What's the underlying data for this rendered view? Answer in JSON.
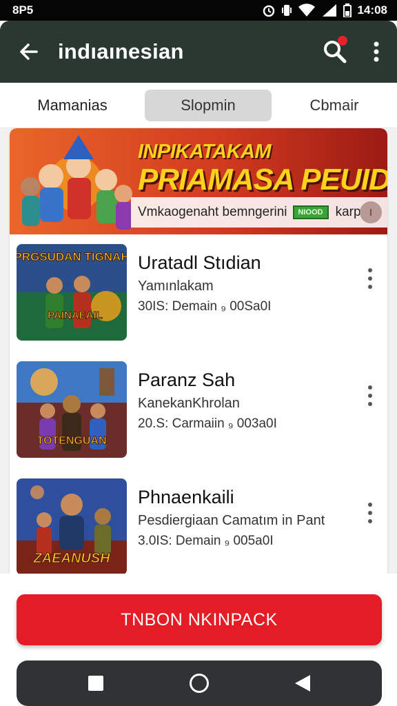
{
  "status_bar": {
    "left_text": "8P5",
    "time": "14:08",
    "icons": [
      "alarm-icon",
      "vibrate-icon",
      "wifi-icon",
      "signal-icon",
      "battery-icon"
    ]
  },
  "app_bar": {
    "title": "indıaınesian",
    "back_icon": "back-arrow-icon",
    "search_icon": "search-icon",
    "more_icon": "more-vert-icon",
    "notification_color": "#e5232e"
  },
  "tabs": [
    {
      "label": "Mamanias",
      "selected": false
    },
    {
      "label": "Slopmin",
      "selected": true
    },
    {
      "label": "Cbmair",
      "selected": false
    }
  ],
  "banner": {
    "headline": "INPIKATAKAM",
    "subheadline": "PRIAMASA PEUID!",
    "strip_text": "Vmkaogenaht bemngerini",
    "badge_text": "NIOOD",
    "link_text": "karpbi",
    "more_label": "I"
  },
  "games": [
    {
      "title": "Uratadl Stıdian",
      "subtitle": "Yamınlakam",
      "meta": "30IS: Demain ₉ 00Sa0I",
      "thumb_text": "PRGSUDAN TIGNAH",
      "thumb_text2": "PAINAEAIL"
    },
    {
      "title": "Paranz Sah",
      "subtitle": "KanekanKhrolan",
      "meta": "20.S: Carmaiin ₉ 003a0I",
      "thumb_text": "TOTENGUAN",
      "thumb_text2": ""
    },
    {
      "title": "Phnaenkaili",
      "subtitle": "Pesdiergiaan Camatım in Pant",
      "meta": "3.0IS: Demain ₉ 005a0I",
      "thumb_text": "ZAEANUSH",
      "thumb_text2": ""
    }
  ],
  "cta": {
    "label": "TNBON NKINPACK",
    "color": "#e31c26"
  },
  "nav_bar": {
    "icons": [
      "recents-square-icon",
      "home-circle-icon",
      "back-triangle-icon"
    ]
  },
  "colors": {
    "app_bar": "#2b3832",
    "accent": "#e31c26",
    "banner_text": "#ffd21e"
  }
}
